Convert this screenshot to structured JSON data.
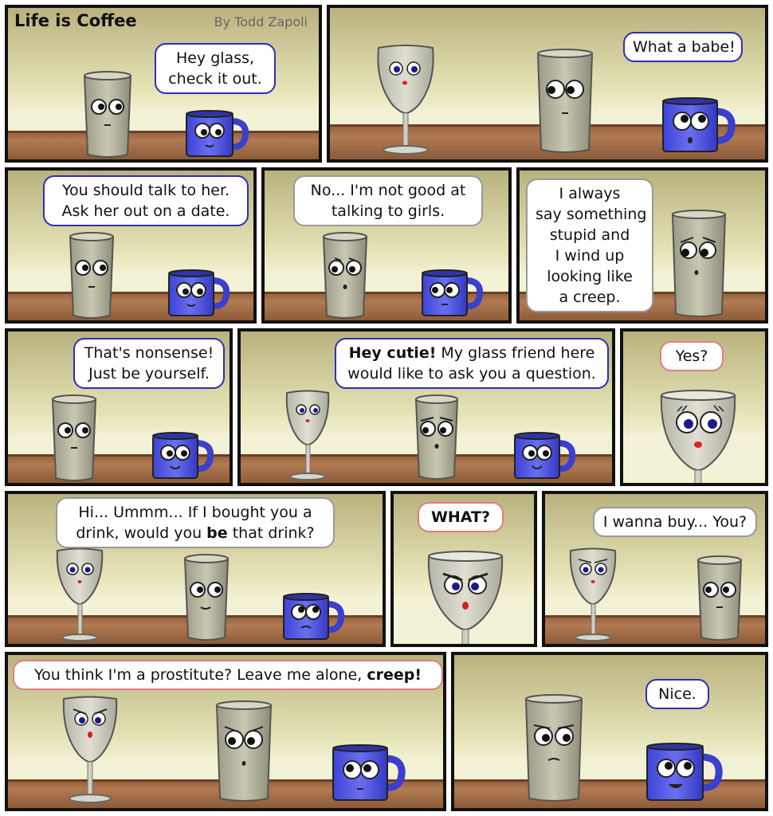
{
  "comic": {
    "title": "Life is Coffee",
    "byline": "By Todd Zapoli"
  },
  "panels": [
    {
      "bubble": [
        "Hey glass,",
        "check it out."
      ]
    },
    {
      "bubble": [
        "What a babe!"
      ]
    },
    {
      "bubble": [
        "You should talk to her.",
        "Ask her out on a date."
      ]
    },
    {
      "bubble": [
        "No... I'm not good at",
        "talking to girls."
      ]
    },
    {
      "bubble": [
        "I always",
        "say something",
        "stupid and",
        "I wind up",
        "looking like",
        "a creep."
      ]
    },
    {
      "bubble": [
        "That's nonsense!",
        "Just be yourself."
      ]
    },
    {
      "bubble_bold": "Hey cutie!",
      "bubble_rest": "  My glass friend here",
      "bubble_line2": "would like to ask you a question."
    },
    {
      "bubble": [
        "Yes?"
      ]
    },
    {
      "bubble_line1": "Hi... Ummm...  If I bought you a",
      "bubble_l2a": "drink, would you ",
      "bubble_l2b": "be",
      "bubble_l2c": " that drink?"
    },
    {
      "bubble_bold": "WHAT?"
    },
    {
      "bubble": [
        "I wanna buy... You?"
      ]
    },
    {
      "bubble_rest": "You think I'm a prostitute?  Leave me alone, ",
      "bubble_bold": "creep!"
    },
    {
      "bubble": [
        "Nice."
      ]
    }
  ]
}
